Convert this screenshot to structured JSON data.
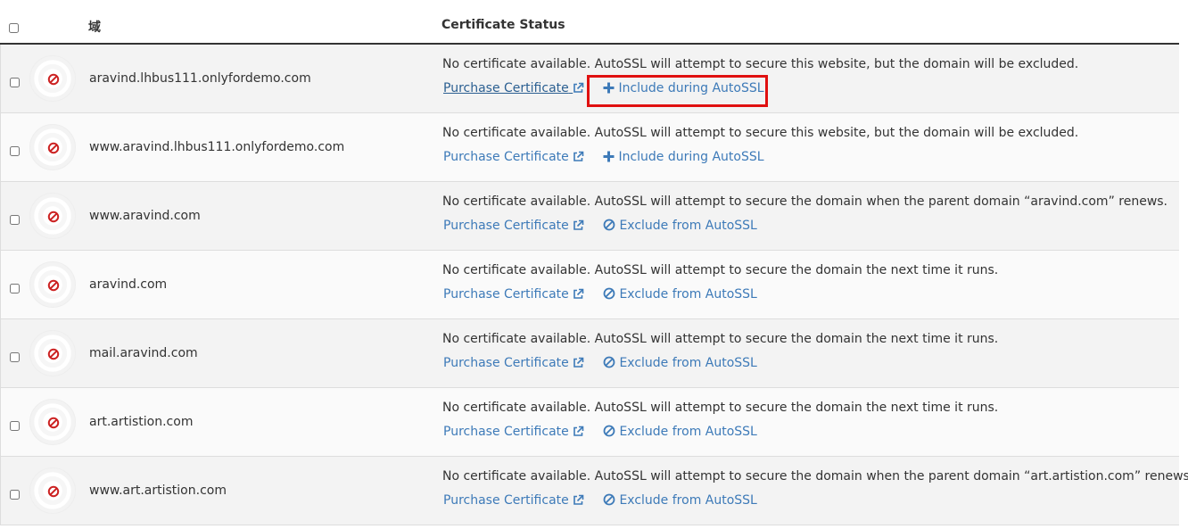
{
  "header": {
    "domain_label": "域",
    "status_label": "Certificate Status"
  },
  "rows": [
    {
      "domain": "aravind.lhbus111.onlyfordemo.com",
      "message": "No certificate available. AutoSSL will attempt to secure this website, but the domain will be excluded.",
      "purchase_label": "Purchase Certificate",
      "action_label": "Include during AutoSSL",
      "action_icon": "plus-icon"
    },
    {
      "domain": "www.aravind.lhbus111.onlyfordemo.com",
      "message": "No certificate available. AutoSSL will attempt to secure this website, but the domain will be excluded.",
      "purchase_label": "Purchase Certificate",
      "action_label": "Include during AutoSSL",
      "action_icon": "plus-icon"
    },
    {
      "domain": "www.aravind.com",
      "message": "No certificate available. AutoSSL will attempt to secure the domain when the parent domain “aravind.com” renews.",
      "purchase_label": "Purchase Certificate",
      "action_label": "Exclude from AutoSSL",
      "action_icon": "ban-icon"
    },
    {
      "domain": "aravind.com",
      "message": "No certificate available. AutoSSL will attempt to secure the domain the next time it runs.",
      "purchase_label": "Purchase Certificate",
      "action_label": "Exclude from AutoSSL",
      "action_icon": "ban-icon"
    },
    {
      "domain": "mail.aravind.com",
      "message": "No certificate available. AutoSSL will attempt to secure the domain the next time it runs.",
      "purchase_label": "Purchase Certificate",
      "action_label": "Exclude from AutoSSL",
      "action_icon": "ban-icon"
    },
    {
      "domain": "art.artistion.com",
      "message": "No certificate available. AutoSSL will attempt to secure the domain the next time it runs.",
      "purchase_label": "Purchase Certificate",
      "action_label": "Exclude from AutoSSL",
      "action_icon": "ban-icon"
    },
    {
      "domain": "www.art.artistion.com",
      "message": "No certificate available. AutoSSL will attempt to secure the domain when the parent domain “art.artistion.com” renews.",
      "purchase_label": "Purchase Certificate",
      "action_label": "Exclude from AutoSSL",
      "action_icon": "ban-icon"
    }
  ],
  "colors": {
    "link": "#3d7ab8",
    "error_icon": "#cc2222",
    "highlight": "#e01010"
  }
}
